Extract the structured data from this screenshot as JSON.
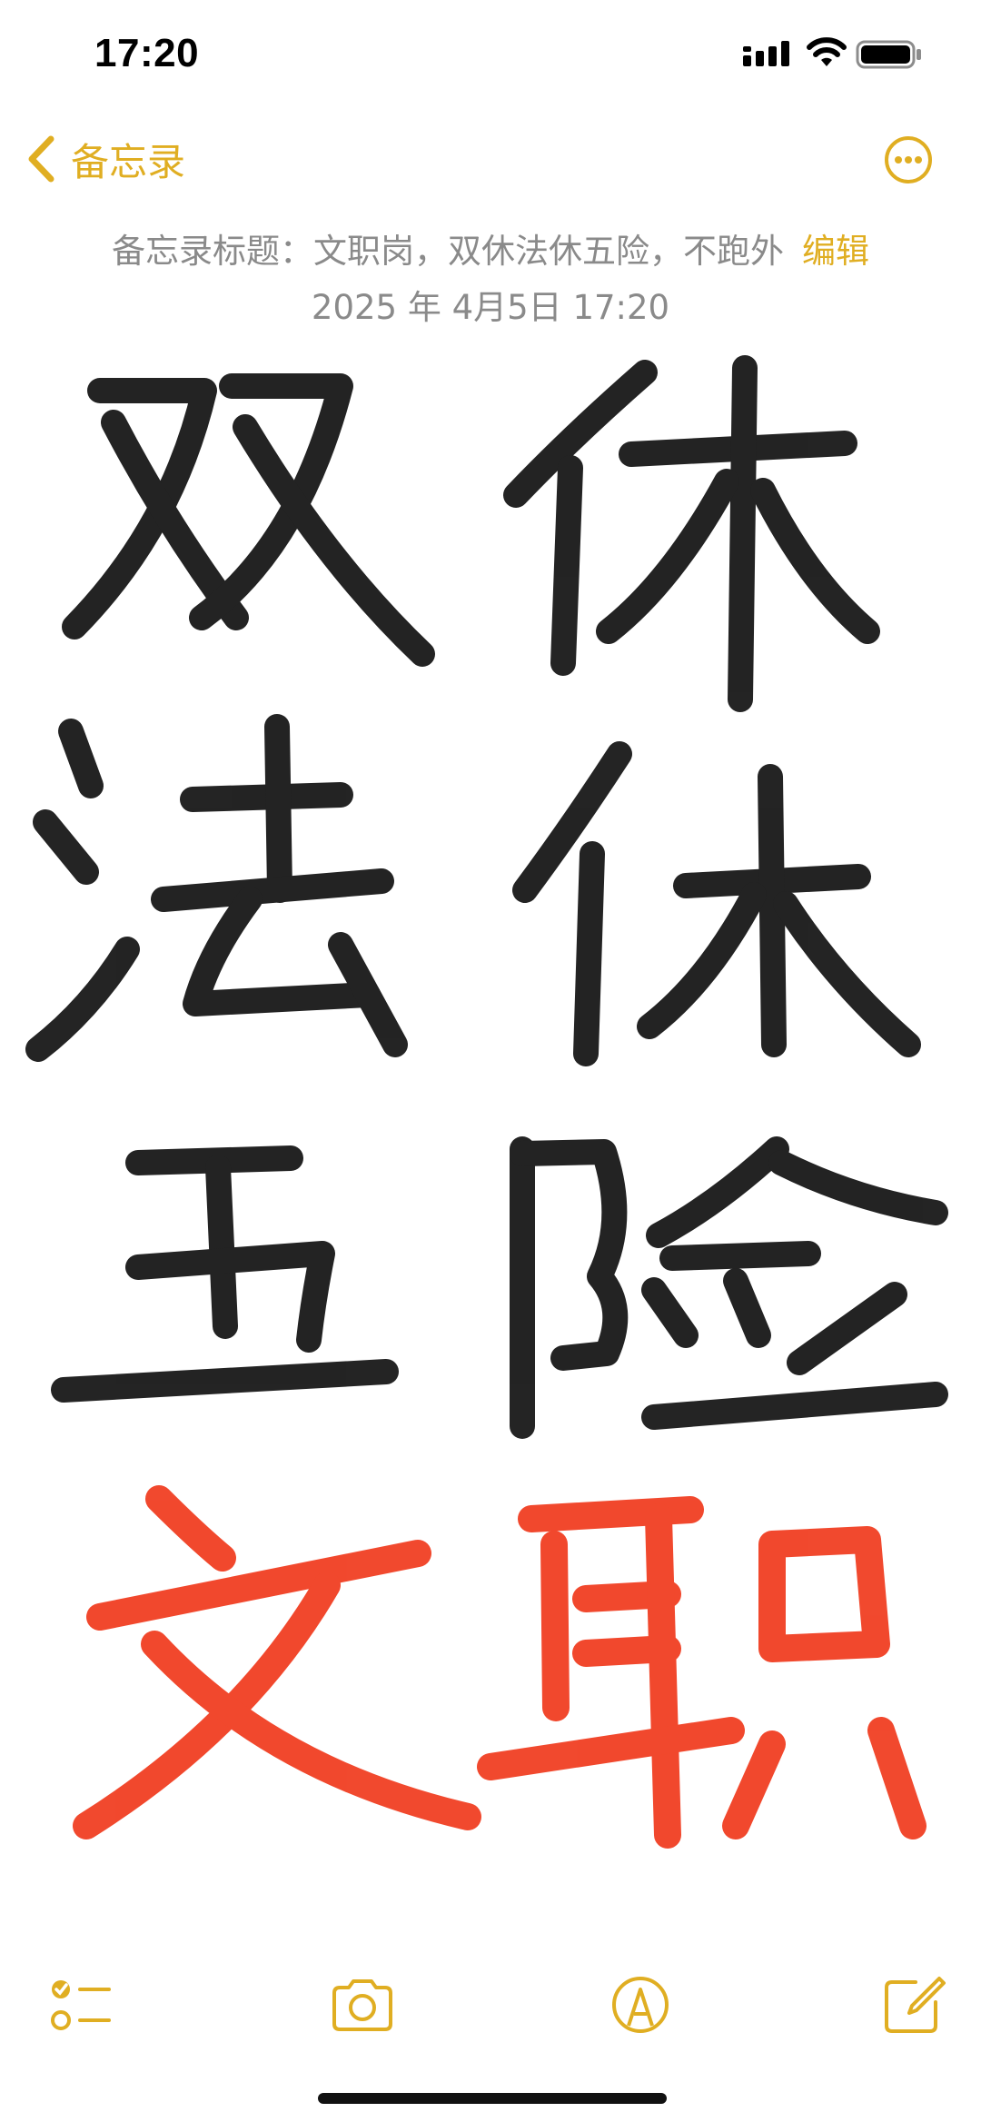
{
  "status_bar": {
    "time": "17:20"
  },
  "nav": {
    "back_label": "备忘录"
  },
  "note": {
    "title_line": "备忘录标题：文职岗，双休法休五险，不跑外",
    "edit_label": "编辑",
    "date": "2025 年 4月5日 17:20",
    "handwriting": [
      {
        "text": "双休",
        "color": "#111111"
      },
      {
        "text": "法休",
        "color": "#111111"
      },
      {
        "text": "五险",
        "color": "#111111"
      },
      {
        "text": "文职",
        "color": "#F0391C"
      }
    ]
  },
  "colors": {
    "accent": "#E0AE22",
    "meta_text": "#8a8a8a",
    "ink_black": "#111111",
    "ink_red": "#F0391C"
  },
  "toolbar": {
    "icons": [
      "checklist-icon",
      "camera-icon",
      "markup-icon",
      "compose-icon"
    ]
  }
}
